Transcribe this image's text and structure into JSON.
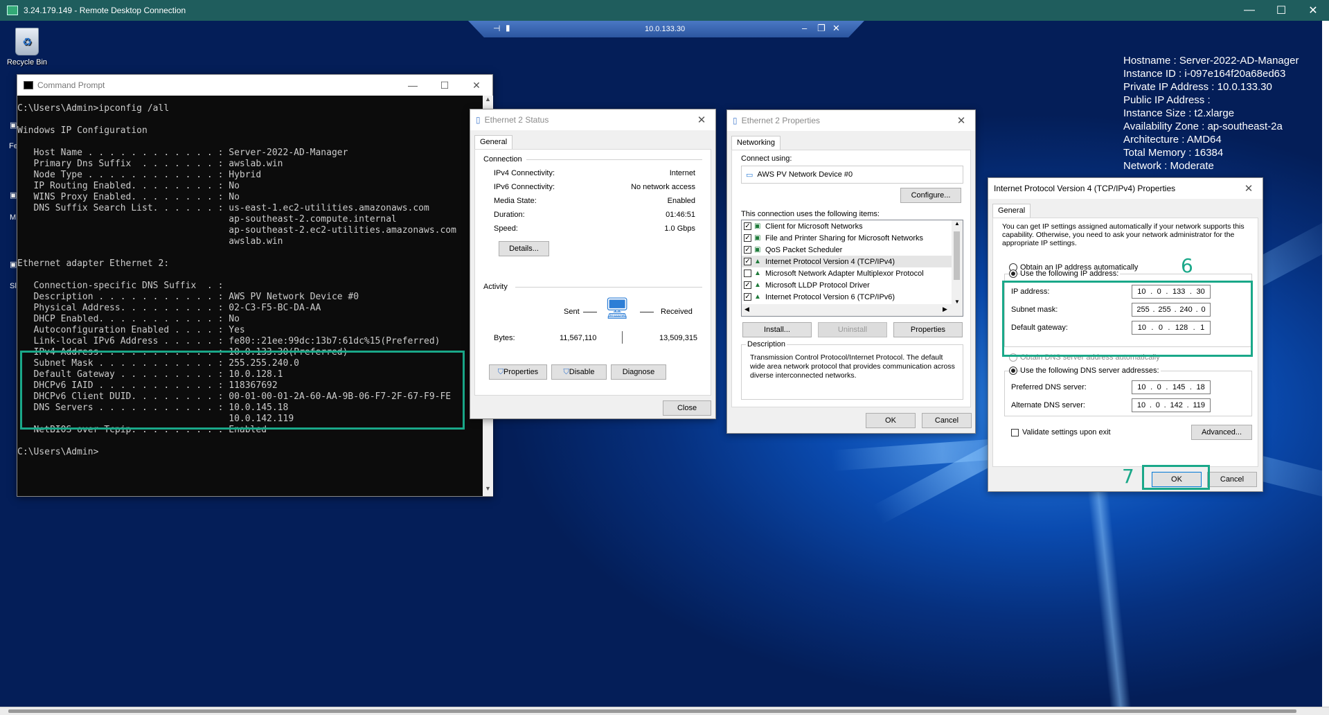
{
  "rdp": {
    "title": "3.24.179.149 - Remote Desktop Connection",
    "connection_bar_ip": "10.0.133.30",
    "minimize": "—",
    "maximize": "☐",
    "close": "✕"
  },
  "desktop": {
    "recycle_bin_label": "Recycle Bin",
    "bginfo": [
      "Hostname : Server-2022-AD-Manager",
      "Instance ID : i-097e164f20a68ed63",
      "Private IP Address : 10.0.133.30",
      "Public IP Address :",
      "Instance Size : t2.xlarge",
      "Availability Zone : ap-southeast-2a",
      "Architecture : AMD64",
      "Total Memory : 16384",
      "Network : Moderate"
    ],
    "edge_labels": [
      "Fe",
      "M",
      "Sl"
    ]
  },
  "cmd": {
    "title": "Command Prompt",
    "lines": [
      "C:\\Users\\Admin>ipconfig /all",
      "",
      "Windows IP Configuration",
      "",
      "   Host Name . . . . . . . . . . . . : Server-2022-AD-Manager",
      "   Primary Dns Suffix  . . . . . . . : awslab.win",
      "   Node Type . . . . . . . . . . . . : Hybrid",
      "   IP Routing Enabled. . . . . . . . : No",
      "   WINS Proxy Enabled. . . . . . . . : No",
      "   DNS Suffix Search List. . . . . . : us-east-1.ec2-utilities.amazonaws.com",
      "                                       ap-southeast-2.compute.internal",
      "                                       ap-southeast-2.ec2-utilities.amazonaws.com",
      "                                       awslab.win",
      "",
      "Ethernet adapter Ethernet 2:",
      "",
      "   Connection-specific DNS Suffix  . :",
      "   Description . . . . . . . . . . . : AWS PV Network Device #0",
      "   Physical Address. . . . . . . . . : 02-C3-F5-BC-DA-AA",
      "   DHCP Enabled. . . . . . . . . . . : No",
      "   Autoconfiguration Enabled . . . . : Yes",
      "   Link-local IPv6 Address . . . . . : fe80::21ee:99dc:13b7:61dc%15(Preferred)",
      "   IPv4 Address. . . . . . . . . . . : 10.0.133.30(Preferred)",
      "   Subnet Mask . . . . . . . . . . . : 255.255.240.0",
      "   Default Gateway . . . . . . . . . : 10.0.128.1",
      "   DHCPv6 IAID . . . . . . . . . . . : 118367692",
      "   DHCPv6 Client DUID. . . . . . . . : 00-01-00-01-2A-60-AA-9B-06-F7-2F-67-F9-FE",
      "   DNS Servers . . . . . . . . . . . : 10.0.145.18",
      "                                       10.0.142.119",
      "   NetBIOS over Tcpip. . . . . . . . : Enabled",
      "",
      "C:\\Users\\Admin>"
    ]
  },
  "status": {
    "title": "Ethernet 2 Status",
    "tab": "General",
    "connection_group": "Connection",
    "rows": [
      {
        "label": "IPv4 Connectivity:",
        "value": "Internet"
      },
      {
        "label": "IPv6 Connectivity:",
        "value": "No network access"
      },
      {
        "label": "Media State:",
        "value": "Enabled"
      },
      {
        "label": "Duration:",
        "value": "01:46:51"
      },
      {
        "label": "Speed:",
        "value": "1.0 Gbps"
      }
    ],
    "details_button": "Details...",
    "activity_group": "Activity",
    "sent_label": "Sent",
    "received_label": "Received",
    "bytes_label": "Bytes:",
    "bytes_sent": "11,567,110",
    "bytes_received": "13,509,315",
    "properties_button": "Properties",
    "disable_button": "Disable",
    "diagnose_button": "Diagnose",
    "close_button": "Close"
  },
  "props": {
    "title": "Ethernet 2 Properties",
    "tab": "Networking",
    "connect_using_label": "Connect using:",
    "adapter_name": "AWS PV Network Device #0",
    "configure_button": "Configure...",
    "items_label": "This connection uses the following items:",
    "items": [
      {
        "label": "Client for Microsoft Networks",
        "checked": true
      },
      {
        "label": "File and Printer Sharing for Microsoft Networks",
        "checked": true
      },
      {
        "label": "QoS Packet Scheduler",
        "checked": true
      },
      {
        "label": "Internet Protocol Version 4 (TCP/IPv4)",
        "checked": true
      },
      {
        "label": "Microsoft Network Adapter Multiplexor Protocol",
        "checked": false
      },
      {
        "label": "Microsoft LLDP Protocol Driver",
        "checked": true
      },
      {
        "label": "Internet Protocol Version 6 (TCP/IPv6)",
        "checked": true
      }
    ],
    "install_button": "Install...",
    "uninstall_button": "Uninstall",
    "properties_button": "Properties",
    "description_label": "Description",
    "description_text": "Transmission Control Protocol/Internet Protocol. The default wide area network protocol that provides communication across diverse interconnected networks.",
    "ok_button": "OK",
    "cancel_button": "Cancel"
  },
  "ipv4": {
    "title": "Internet Protocol Version 4 (TCP/IPv4) Properties",
    "tab": "General",
    "intro": "You can get IP settings assigned automatically if your network supports this capability. Otherwise, you need to ask your network administrator for the appropriate IP settings.",
    "obtain_auto": "Obtain an IP address automatically",
    "use_following": "Use the following IP address:",
    "ip_label": "IP address:",
    "ip": [
      "10",
      "0",
      "133",
      "30"
    ],
    "mask_label": "Subnet mask:",
    "mask": [
      "255",
      "255",
      "240",
      "0"
    ],
    "gw_label": "Default gateway:",
    "gw": [
      "10",
      "0",
      "128",
      "1"
    ],
    "dns_auto": "Obtain DNS server address automatically",
    "dns_use": "Use the following DNS server addresses:",
    "pref_label": "Preferred DNS server:",
    "pref": [
      "10",
      "0",
      "145",
      "18"
    ],
    "alt_label": "Alternate DNS server:",
    "alt": [
      "10",
      "0",
      "142",
      "119"
    ],
    "validate_label": "Validate settings upon exit",
    "advanced_button": "Advanced...",
    "ok_button": "OK",
    "cancel_button": "Cancel",
    "callout_6": "6",
    "callout_7": "7"
  },
  "colors": {
    "highlight": "#1aa889",
    "rdp_titlebar": "#1f5d5d"
  }
}
